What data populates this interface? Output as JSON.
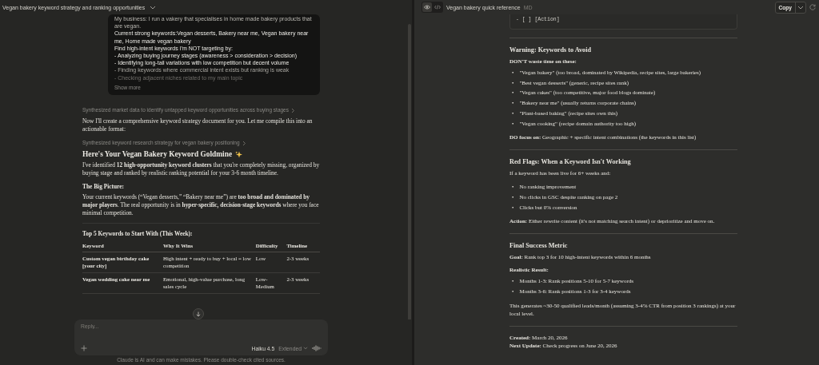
{
  "chat": {
    "conversation_title": "Vegan bakery keyword strategy and ranking opportunities",
    "user_message": {
      "lines": [
        "My business: I run a vakery that specialises in home made bakery products that are vegan.",
        "Current strong keywords:Vegan desserts, Bakery near me, Vegan bakery near me, Home made vegan bakery",
        "Find high-intent keywords I'm NOT targeting by:",
        "- Analyzing buying journey stages (awareness > consideration > decision)",
        "- Identifying long-tail variations with low competition but decent volume",
        "- Finding keywords where commercial intent exists but ranking is weak",
        "- Checking adjacent niches related to my main topic"
      ],
      "show_more": "Show more"
    },
    "blocks": [
      {
        "kind": "step",
        "text": "Synthesized market data to identify untapped keyword opportunities across buying stages"
      },
      {
        "kind": "paragraph",
        "text": "Now I'll create a comprehensive keyword strategy document for you. Let me compile this into an actionable format:"
      },
      {
        "kind": "step",
        "text": "Synthesized keyword research strategy for vegan bakery positioning"
      },
      {
        "kind": "heading",
        "text": "Here's Your Vegan Bakery Keyword Goldmine"
      },
      {
        "kind": "paragraph",
        "text": "I've identified **12 high-opportunity keyword clusters** that you're completely missing, organized by buying stage and ranked by realistic ranking potential for your 3-6 month timeline."
      },
      {
        "kind": "subheading",
        "text": "The Big Picture:"
      },
      {
        "kind": "paragraph",
        "text": "Your current keywords (“Vegan desserts,” “Bakery near me”) are **too broad and dominated by major players**. The real opportunity is in **hyper-specific, decision-stage keywords** where you face minimal competition."
      },
      {
        "kind": "divider"
      },
      {
        "kind": "subheading",
        "text": "Top 5 Keywords to Start With (This Week):"
      },
      {
        "kind": "table",
        "columns": [
          "Keyword",
          "Why It Wins",
          "Difficulty",
          "Timeline"
        ],
        "rows": [
          [
            "Custom vegan birthday cake [your city]",
            "High intent + ready to buy + local = low competition",
            "Low",
            "2-3 weeks"
          ],
          [
            "Vegan wedding cake near me",
            "Emotional, high-value purchase, long sales cycle",
            "Low-Medium",
            "2-3 weeks"
          ]
        ]
      }
    ],
    "reply_box": {
      "placeholder": "Reply...",
      "model": "Haiku 4.5",
      "mode": "Extended"
    },
    "disclaimer": "Claude is AI and can make mistakes. Please double-check cited sources."
  },
  "document": {
    "view_tabs": [
      {
        "kind": "preview",
        "selected": true
      },
      {
        "kind": "code",
        "selected": false
      }
    ],
    "title": "Vegan bakery quick reference",
    "badge": "MD",
    "copy_button": "Copy",
    "code_tail": "- [ ] [Action]",
    "blocks": [
      {
        "kind": "divider"
      },
      {
        "kind": "heading",
        "text": "Warning: Keywords to Avoid"
      },
      {
        "kind": "strong",
        "text": "DON'T waste time on these:"
      },
      {
        "kind": "bullets",
        "marker": "•",
        "items": [
          "\"Vegan bakery\" (too broad, dominated by Wikipedia, recipe sites, large bakeries)",
          "\"Best vegan desserts\" (generic, recipe sites rank)",
          "\"Vegan cakes\" (too competitive, major food blogs dominate)",
          "\"Bakery near me\" (usually returns corporate chains)",
          "\"Plant-based baking\" (recipe sites own this)",
          "\"Vegan cooking\" (recipe domain authority too high)"
        ]
      },
      {
        "kind": "paragraph",
        "text": "**DO focus on:** Geographic + specific intent combinations (the keywords in this list)"
      },
      {
        "kind": "divider"
      },
      {
        "kind": "heading",
        "text": "Red Flags: When a Keyword Isn't Working"
      },
      {
        "kind": "paragraph",
        "text": "If a keyword has been live for 6+ weeks and:"
      },
      {
        "kind": "bullets",
        "marker": "•",
        "items": [
          "No ranking improvement",
          "No clicks in GSC despite ranking on page 2",
          "Clicks but 0% conversion"
        ]
      },
      {
        "kind": "paragraph",
        "text": "**Action:** Either rewrite content (it's not matching search intent) or deprioritize and move on."
      },
      {
        "kind": "divider"
      },
      {
        "kind": "heading",
        "text": "Final Success Metric"
      },
      {
        "kind": "paragraph",
        "text": "**Goal:** Rank top 3 for 10 high-intent keywords within 6 months"
      },
      {
        "kind": "strong",
        "text": "Realistic Result:"
      },
      {
        "kind": "bullets",
        "marker": "•",
        "items": [
          "Months 1-3: Rank positions 5-10 for 5-7 keywords",
          "Months 3-6: Rank positions 1-3 for 3-4 keywords"
        ]
      },
      {
        "kind": "paragraph",
        "text": "This generates ~30-50 qualified leads/month (assuming 3-4% CTR from position 3 rankings) at your local level."
      },
      {
        "kind": "divider"
      },
      {
        "kind": "meta",
        "lines": [
          "**Created:** March 20, 2026",
          "**Next Update:** Check progress on June 20, 2026"
        ]
      }
    ]
  }
}
